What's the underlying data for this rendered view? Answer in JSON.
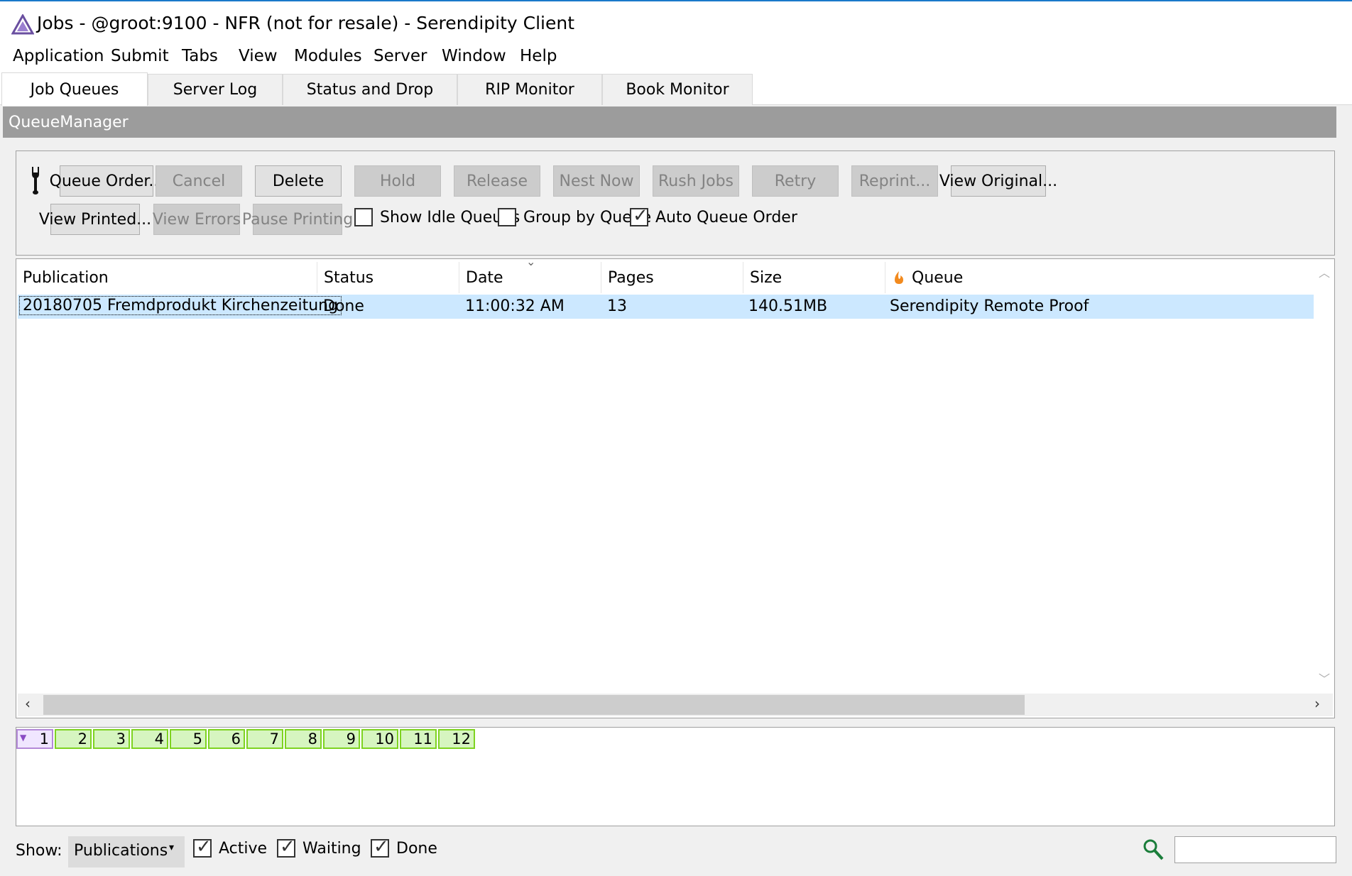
{
  "window": {
    "title": "Jobs - @groot:9100 - NFR (not for resale) - Serendipity Client"
  },
  "menu": [
    "Application",
    "Submit",
    "Tabs",
    "View",
    "Modules",
    "Server",
    "Window",
    "Help"
  ],
  "tabs": [
    "Job Queues",
    "Server Log",
    "Status and Drop",
    "RIP Monitor",
    "Book Monitor"
  ],
  "panel_title": "QueueManager",
  "toolbar": {
    "row1": [
      "Queue Order...",
      "Cancel",
      "Delete",
      "Hold",
      "Release",
      "Nest Now",
      "Rush Jobs",
      "Retry",
      "Reprint...",
      "View Original..."
    ],
    "row2": [
      "View Printed...",
      "View Errors",
      "Pause Printing"
    ],
    "checkboxes": [
      {
        "label": "Show Idle Queues",
        "checked": false
      },
      {
        "label": "Group by Queue",
        "checked": false
      },
      {
        "label": "Auto Queue Order",
        "checked": true
      }
    ]
  },
  "table": {
    "columns": [
      "Publication",
      "Status",
      "Date",
      "Pages",
      "Size",
      "Queue"
    ],
    "rows": [
      {
        "publication": "20180705  Fremdprodukt  Kirchenzeitung",
        "status": "Done",
        "date": "11:00:32 AM",
        "pages": "13",
        "size": "140.51MB",
        "queue": "Serendipity Remote Proof"
      }
    ]
  },
  "pages": [
    "1",
    "2",
    "3",
    "4",
    "5",
    "6",
    "7",
    "8",
    "9",
    "10",
    "11",
    "12"
  ],
  "status": {
    "show_label": "Show:",
    "show_value": "Publications",
    "filters": [
      {
        "label": "Active",
        "checked": true
      },
      {
        "label": "Waiting",
        "checked": true
      },
      {
        "label": "Done",
        "checked": true
      }
    ],
    "search_value": ""
  },
  "colors": {
    "accent": "#1979ca",
    "selection": "#cce8ff",
    "page_ok": "#7ed321",
    "header_gray": "#9c9c9c"
  }
}
